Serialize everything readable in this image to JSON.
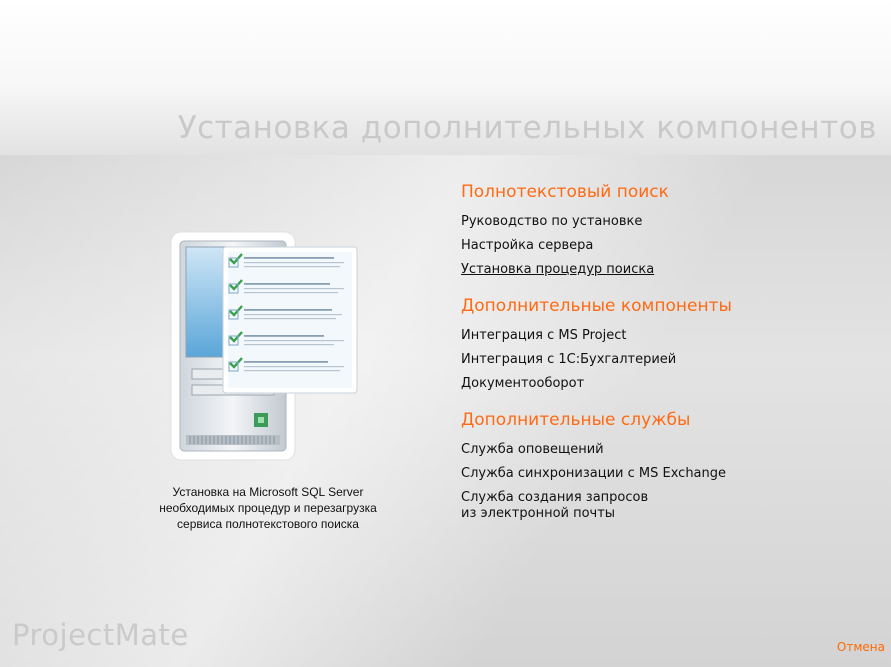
{
  "window": {
    "title": "Установка дополнительных компонентов",
    "brand": "ProjectMate",
    "cancel_label": "Отмена"
  },
  "illustration": {
    "icon": "server-checklist-icon",
    "caption_lines": [
      "Установка на Microsoft SQL Server",
      "необходимых процедур и перезагрузка",
      "сервиса полнотекстового поиска"
    ]
  },
  "sections": [
    {
      "title": "Полнотекстовый поиск",
      "items": [
        {
          "label": "Руководство по установке"
        },
        {
          "label": "Настройка сервера"
        },
        {
          "label": "Установка процедур поиска",
          "active": true
        }
      ]
    },
    {
      "title": "Дополнительные компоненты",
      "items": [
        {
          "label": "Интеграция с MS Project"
        },
        {
          "label": "Интеграция с 1С:Бухгалтерией"
        },
        {
          "label": "Документооборот"
        }
      ]
    },
    {
      "title": "Дополнительные службы",
      "items": [
        {
          "label": "Служба оповещений"
        },
        {
          "label": "Служба синхронизации с MS Exchange"
        },
        {
          "label_lines": [
            "Служба создания запросов",
            "из электронной почты"
          ]
        }
      ]
    }
  ],
  "colors": {
    "accent": "#ff6a12",
    "title_gray": "#c9c9c9"
  }
}
